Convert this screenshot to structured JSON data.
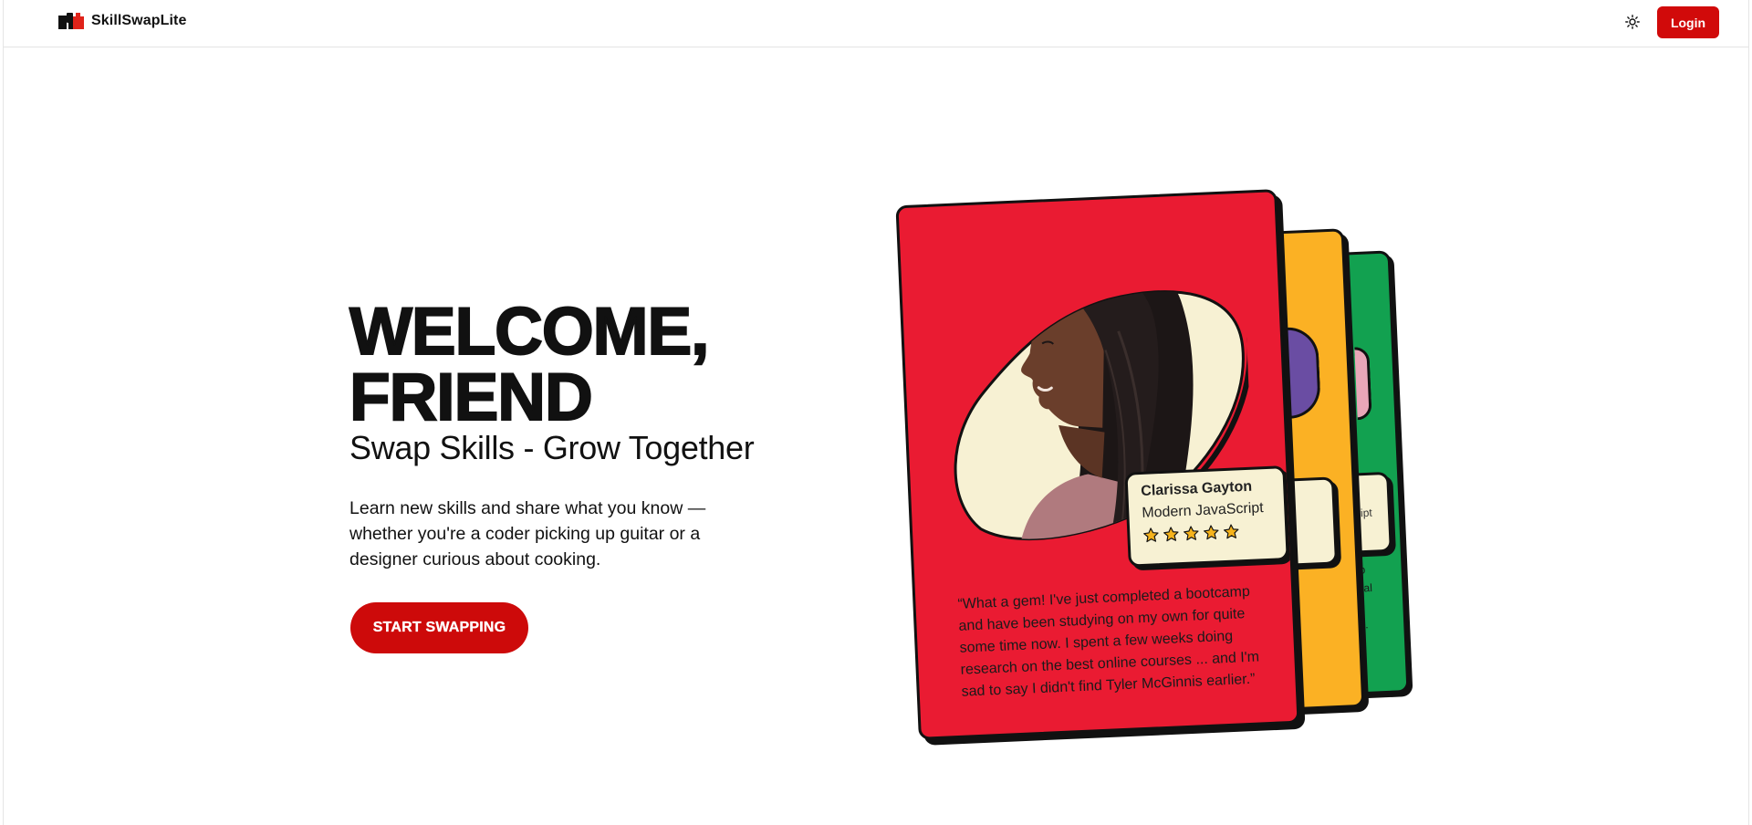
{
  "header": {
    "brand_name": "SkillSwapLite",
    "theme_toggle_icon": "sun-icon",
    "login_label": "Login"
  },
  "hero": {
    "title_line1": "WELCOME,",
    "title_line2": "FRIEND",
    "subtitle": "Swap Skills - Grow Together",
    "description": "Learn new skills and share what you know — whether you're a coder picking up guitar or a designer curious about cooking.",
    "cta_label": "START SWAPPING"
  },
  "testimonial": {
    "name": "Clarissa Gayton",
    "skill": "Modern JavaScript",
    "rating": 5,
    "quote": "“What a gem! I've just completed a bootcamp and have been studying on my own for quite some time now. I spent a few weeks doing research on the best online courses ... and I'm sad to say I didn't find Tyler McGinnis earlier.”"
  },
  "peek_cards": {
    "green_skill_fragment": "cript",
    "green_quote_fragment": "ulb\nonal\nto\nne.\ne."
  },
  "colors": {
    "accent_red": "#d10a0a",
    "card_red": "#ea1b32",
    "card_yellow": "#fbb124",
    "card_green": "#12a150",
    "card_panel": "#f7f1d3"
  }
}
